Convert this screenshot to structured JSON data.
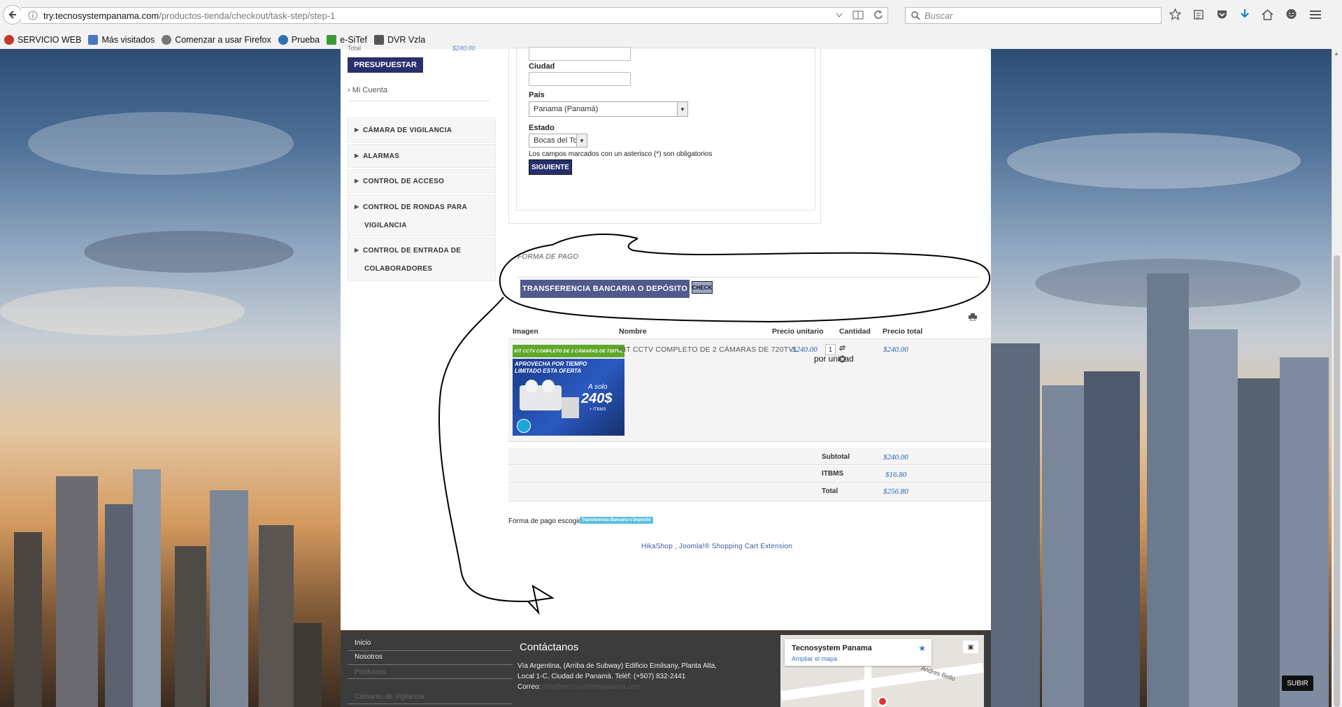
{
  "browser": {
    "url_host": "try.tecnosystempanama.com",
    "url_path": "/productos-tienda/checkout/task-step/step-1",
    "search_placeholder": "Buscar",
    "bookmarks": [
      {
        "label": "SERVICIO WEB",
        "color": "#c0392b"
      },
      {
        "label": "Más visitados",
        "color": "#4a78c2"
      },
      {
        "label": "Comenzar a usar Firefox",
        "color": "#777777"
      },
      {
        "label": "Prueba",
        "color": "#2e6fb3"
      },
      {
        "label": "e-SiTef",
        "color": "#3a9a3a"
      },
      {
        "label": "DVR Vzla",
        "color": "#555555"
      }
    ]
  },
  "sidebar": {
    "total_label": "Total",
    "total_value": "$240.00",
    "presupuestar_label": "PRESUPUESTAR",
    "mi_cuenta": "Mi Cuenta",
    "categories": [
      {
        "line1": "CÁMARA DE VIGILANCIA",
        "line2": ""
      },
      {
        "line1": "ALARMAS",
        "line2": ""
      },
      {
        "line1": "CONTROL DE ACCESO",
        "line2": ""
      },
      {
        "line1": "CONTROL DE RONDAS PARA",
        "line2": "VIGILANCIA"
      },
      {
        "line1": "CONTROL DE ENTRADA DE",
        "line2": "COLABORADORES"
      }
    ]
  },
  "form": {
    "ciudad_label": "Ciudad",
    "pais_label": "País",
    "pais_value": "Panama (Panamá)",
    "estado_label": "Estado",
    "estado_value": "Bocas del Toro",
    "required_note": "Los campos marcados con un asterisco (*) son obligatorios",
    "siguiente_label": "SIGUIENTE"
  },
  "payment": {
    "title": "FORMA DE PAGO",
    "method_label": "TRANSFERENCIA BANCARIA O DEPÓSITO",
    "check_label": "CHECK"
  },
  "cart": {
    "headers": {
      "imagen": "Imagen",
      "nombre": "Nombre",
      "precio_unitario": "Precio unitario",
      "cantidad": "Cantidad",
      "precio_total": "Precio total"
    },
    "item": {
      "name": "KIT CCTV COMPLETO DE 2 CÁMARAS DE 720TVL",
      "unit_price": "$240.00",
      "per_unit": "por unidad",
      "quantity": "1",
      "total": "$240.00",
      "image": {
        "banner": "KIT CCTV COMPLETO DE 2 CÁMARAS DE 720TVL",
        "promo_line1": "APROVECHA POR TIEMPO",
        "promo_line2": "LIMITADO ESTA OFERTA",
        "a_solo": "A solo",
        "price": "240$",
        "itbms": "+ ITBMS"
      }
    },
    "totals": [
      {
        "label": "Subtotal",
        "value": "$240.00"
      },
      {
        "label": "ITBMS",
        "value": "$16.80"
      },
      {
        "label": "Total",
        "value": "$256.80"
      }
    ],
    "chosen_label": "Forma de pago escogida:",
    "chosen_value": "Transferencia Bancaria o Depósito",
    "credits": "HikaShop , Joomla!® Shopping Cart Extension"
  },
  "footer": {
    "links": [
      "Inicio",
      "Nosotros",
      "Productos",
      "Cámaras de Vigilancia"
    ],
    "contact_title": "Contáctanos",
    "address": "Vía Argentina, (Arriba de Subway) Edificio Emilsany, Planta Alta, Local 1-C. Ciudad de Panamá. Teléf: (+507) 832-2441",
    "correo_label": "Correo:",
    "correo_value": "info@tecnosystempanama.com",
    "map_title": "Tecnosystem Panama",
    "map_link": "Ampliar el mapa",
    "map_road": "Andres Bello",
    "subir": "SUBIR"
  },
  "colors": {
    "primary_button": "#27306b",
    "payment_button": "#505a8c",
    "price": "#2a62b0",
    "annotation": "#000000"
  }
}
